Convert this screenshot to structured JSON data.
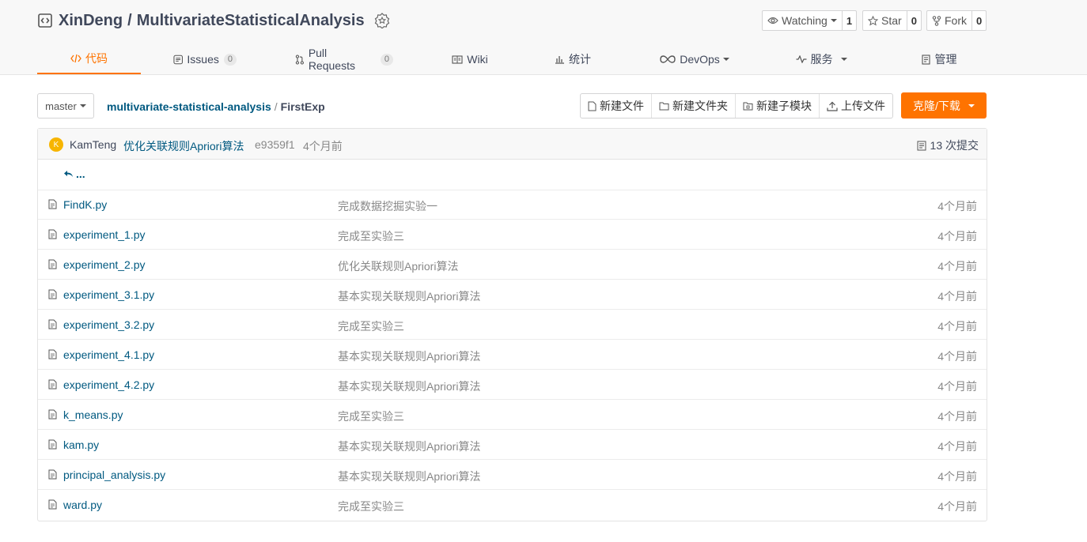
{
  "repo": {
    "owner": "XinDeng",
    "separator": "/",
    "name": "MultivariateStatisticalAnalysis"
  },
  "actions": {
    "watch": {
      "label": "Watching",
      "count": "1"
    },
    "star": {
      "label": "Star",
      "count": "0"
    },
    "fork": {
      "label": "Fork",
      "count": "0"
    }
  },
  "tabs": {
    "code": "代码",
    "issues": {
      "label": "Issues",
      "count": "0"
    },
    "pulls": {
      "label": "Pull Requests",
      "count": "0"
    },
    "wiki": "Wiki",
    "stats": "统计",
    "devops": "DevOps",
    "services": "服务",
    "manage": "管理"
  },
  "accent_color": "#fe7300",
  "link_color": "#005980",
  "branch": "master",
  "breadcrumb": {
    "root": "multivariate-statistical-analysis",
    "separator": "/",
    "current": "FirstExp"
  },
  "toolbar": {
    "new_file": "新建文件",
    "new_folder": "新建文件夹",
    "new_submodule": "新建子模块",
    "upload": "上传文件",
    "clone": "克隆/下载"
  },
  "commit": {
    "avatar_letter": "K",
    "author": "KamTeng",
    "message": "优化关联规则Apriori算法",
    "sha": "e9359f1",
    "time": "4个月前",
    "count_label": "13 次提交"
  },
  "parent_dir": "...",
  "files": [
    {
      "name": "FindK.py",
      "message": "完成数据挖掘实验一",
      "time": "4个月前"
    },
    {
      "name": "experiment_1.py",
      "message": "完成至实验三",
      "time": "4个月前"
    },
    {
      "name": "experiment_2.py",
      "message": "优化关联规则Apriori算法",
      "time": "4个月前"
    },
    {
      "name": "experiment_3.1.py",
      "message": "基本实现关联规则Apriori算法",
      "time": "4个月前"
    },
    {
      "name": "experiment_3.2.py",
      "message": "完成至实验三",
      "time": "4个月前"
    },
    {
      "name": "experiment_4.1.py",
      "message": "基本实现关联规则Apriori算法",
      "time": "4个月前"
    },
    {
      "name": "experiment_4.2.py",
      "message": "基本实现关联规则Apriori算法",
      "time": "4个月前"
    },
    {
      "name": "k_means.py",
      "message": "完成至实验三",
      "time": "4个月前"
    },
    {
      "name": "kam.py",
      "message": "基本实现关联规则Apriori算法",
      "time": "4个月前"
    },
    {
      "name": "principal_analysis.py",
      "message": "基本实现关联规则Apriori算法",
      "time": "4个月前"
    },
    {
      "name": "ward.py",
      "message": "完成至实验三",
      "time": "4个月前"
    }
  ]
}
